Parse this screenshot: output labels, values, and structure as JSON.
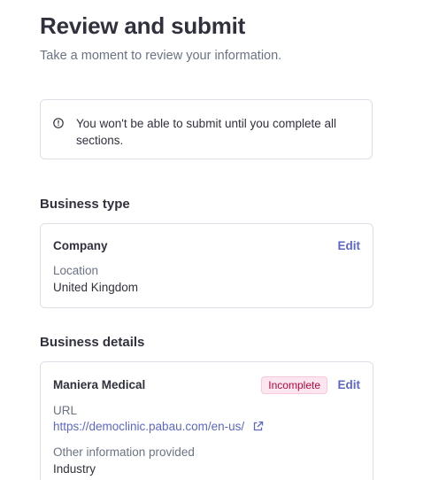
{
  "header": {
    "title": "Review and submit",
    "subtitle": "Take a moment to review your information."
  },
  "notice": {
    "icon": "info-circle-icon",
    "text": "You won't be able to submit until you complete all sections."
  },
  "business_type": {
    "heading": "Business type",
    "card": {
      "title": "Company",
      "edit_label": "Edit",
      "location_label": "Location",
      "location_value": "United Kingdom"
    }
  },
  "business_details": {
    "heading": "Business details",
    "card": {
      "title": "Maniera Medical",
      "status_badge": "Incomplete",
      "edit_label": "Edit",
      "url_label": "URL",
      "url_value": "https://democlinic.pabau.com/en-us/",
      "url_icon": "external-link-icon",
      "other_label": "Other information provided",
      "other_value": "Industry"
    }
  },
  "colors": {
    "text": "#30313d",
    "muted": "#6a7383",
    "accent": "#5c67c8",
    "border": "#dcdfe6",
    "badge_text": "#b3093c",
    "badge_bg": "#fde6ef"
  }
}
